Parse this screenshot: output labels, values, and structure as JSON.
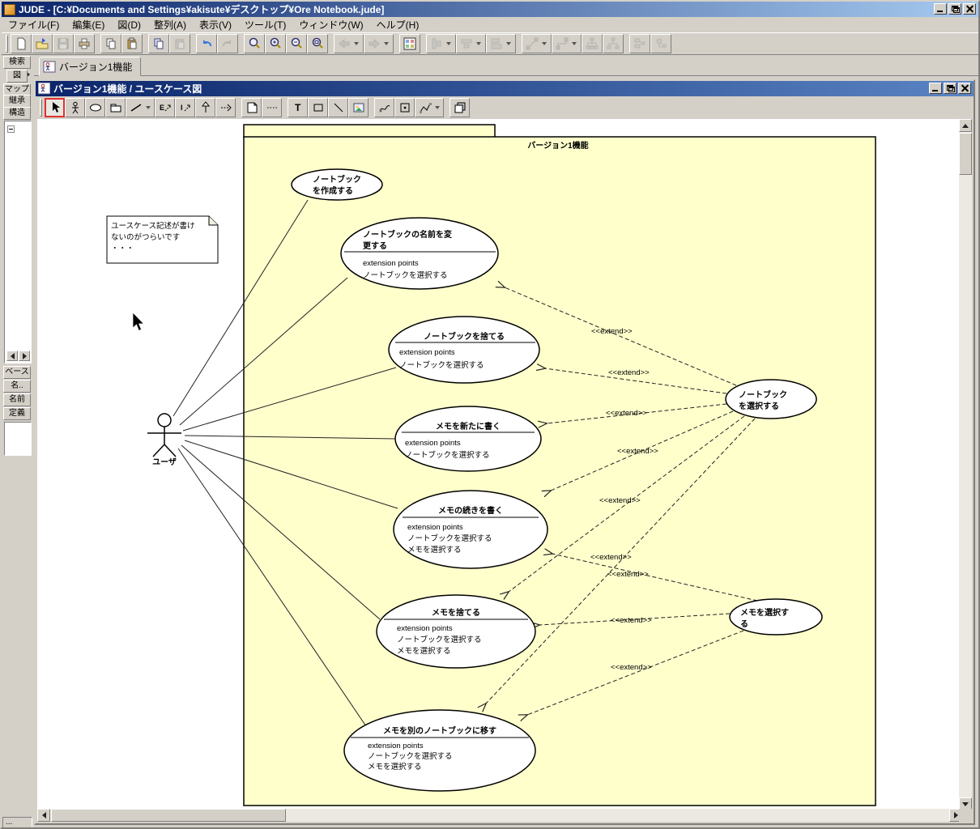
{
  "colors": {
    "titlebar_left": "#0a246a",
    "titlebar_right": "#a6caf0",
    "chrome": "#d4d0c8",
    "package_fill": "#ffffcc",
    "selected_tool_border": "#e03030"
  },
  "window": {
    "title": "JUDE - [C:¥Documents and Settings¥akisute¥デスクトップ¥Ore Notebook.jude]"
  },
  "menu": {
    "items": [
      "ファイル(F)",
      "編集(E)",
      "図(D)",
      "整列(A)",
      "表示(V)",
      "ツール(T)",
      "ウィンドウ(W)",
      "ヘルプ(H)"
    ]
  },
  "toolbar": {
    "icons": [
      "new-file",
      "open-file",
      "save",
      "print",
      "copy",
      "paste",
      "copy-image",
      "paste-image",
      "undo",
      "redo",
      "zoom-tool",
      "zoom-in",
      "zoom-out",
      "zoom-fit",
      "nav-back",
      "nav-forward",
      "diagram-map",
      "align-vertical",
      "align-horizontal",
      "size-adjust",
      "line-diagonal",
      "line-orthogonal",
      "tree-vertical",
      "tree-horizontal",
      "align-list",
      "align-parts"
    ]
  },
  "doc_tab": {
    "label": "バージョン1機能"
  },
  "sidebar": {
    "top_tabs": [
      "検索",
      "図",
      "マップ",
      "継承",
      "構造"
    ],
    "bottom_tabs": [
      "ベース",
      "名..",
      "名前",
      "定義"
    ]
  },
  "inner_window": {
    "title": "バージョン1機能 / ユースケース図"
  },
  "diagram_toolbar": {
    "glyphs": {
      "extend": "E",
      "include": "I",
      "text": "T"
    },
    "icons": [
      "pointer",
      "actor",
      "usecase",
      "package",
      "association",
      "extend",
      "include",
      "generalization",
      "dependency",
      "note",
      "note-anchor",
      "text",
      "rectangle",
      "line",
      "image",
      "freehand",
      "viewport",
      "polyline",
      "depth-order"
    ]
  },
  "statusbar": {
    "text": "..."
  },
  "diagram": {
    "package": {
      "name": "バージョン1機能"
    },
    "note": {
      "lines": [
        "ユースケース記述が書け",
        "ないのがつらいです",
        "・・・"
      ]
    },
    "actor": {
      "label": "ユーザ"
    },
    "extend_label": "<<extend>>",
    "usecases": [
      {
        "name_lines": [
          "ノートブック",
          "を作成する"
        ],
        "ext_lines": []
      },
      {
        "name_lines": [
          "ノートブックの名前を変",
          "更する"
        ],
        "ext_lines": [
          "extension points",
          "ノートブックを選択する"
        ]
      },
      {
        "name_lines": [
          "ノートブックを捨てる"
        ],
        "ext_lines": [
          "extension points",
          "ノートブックを選択する"
        ]
      },
      {
        "name_lines": [
          "メモを新たに書く"
        ],
        "ext_lines": [
          "extension points",
          "ノートブックを選択する"
        ]
      },
      {
        "name_lines": [
          "メモの続きを書く"
        ],
        "ext_lines": [
          "extension points",
          "ノートブックを選択する",
          "メモを選択する"
        ]
      },
      {
        "name_lines": [
          "メモを捨てる"
        ],
        "ext_lines": [
          "extension points",
          "ノートブックを選択する",
          "メモを選択する"
        ]
      },
      {
        "name_lines": [
          "メモを別のノートブックに移す"
        ],
        "ext_lines": [
          "extension points",
          "ノートブックを選択する",
          "メモを選択する"
        ]
      },
      {
        "name_lines": [
          "ノートブック",
          "を選択する"
        ],
        "ext_lines": []
      },
      {
        "name_lines": [
          "メモを選択す",
          "る"
        ],
        "ext_lines": []
      }
    ]
  }
}
